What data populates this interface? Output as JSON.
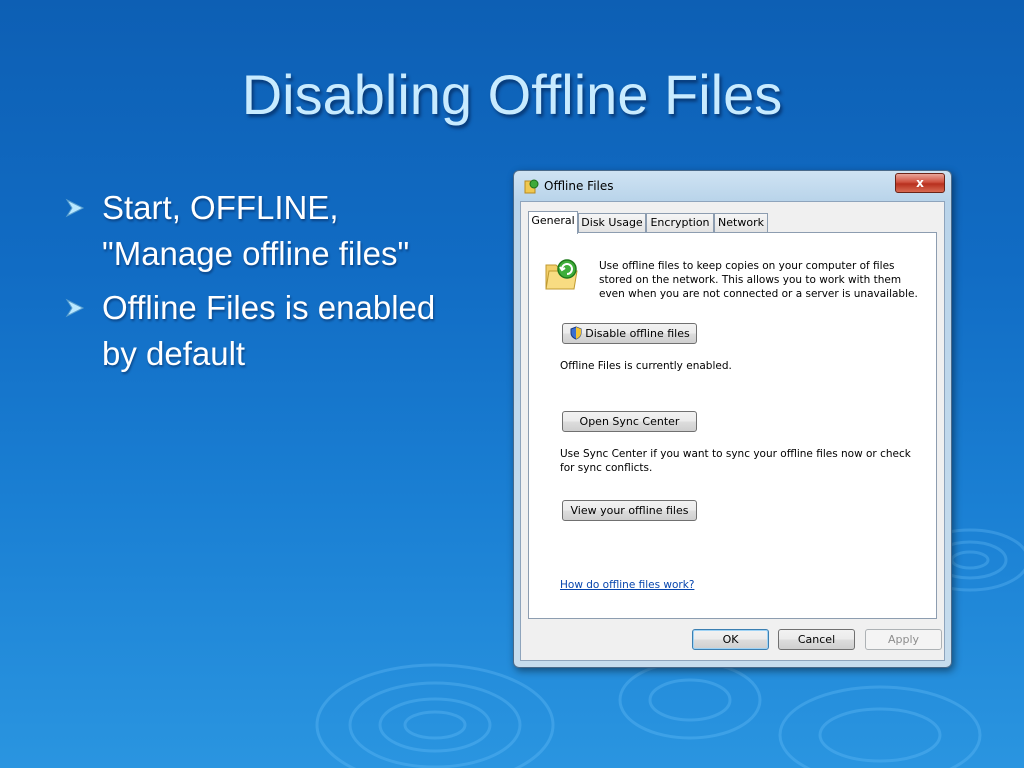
{
  "slide": {
    "title": "Disabling Offline Files",
    "bullets": [
      "Start, OFFLINE, \"Manage offline files\"",
      "Offline Files is enabled by default"
    ]
  },
  "dialog": {
    "title": "Offline Files",
    "close_label": "x",
    "tabs": [
      "General",
      "Disk Usage",
      "Encryption",
      "Network"
    ],
    "description": "Use offline files to keep copies on your computer of files stored on the network.  This allows you to work with them even when you are not connected or a server is unavailable.",
    "disable_button": "Disable offline files",
    "status_text": "Offline Files is currently enabled.",
    "sync_button": "Open Sync Center",
    "sync_text": "Use Sync Center if you want to sync your offline files now or check for sync conflicts.",
    "view_button": "View your offline files",
    "help_link": "How do offline files work?",
    "ok_label": "OK",
    "cancel_label": "Cancel",
    "apply_label": "Apply"
  }
}
